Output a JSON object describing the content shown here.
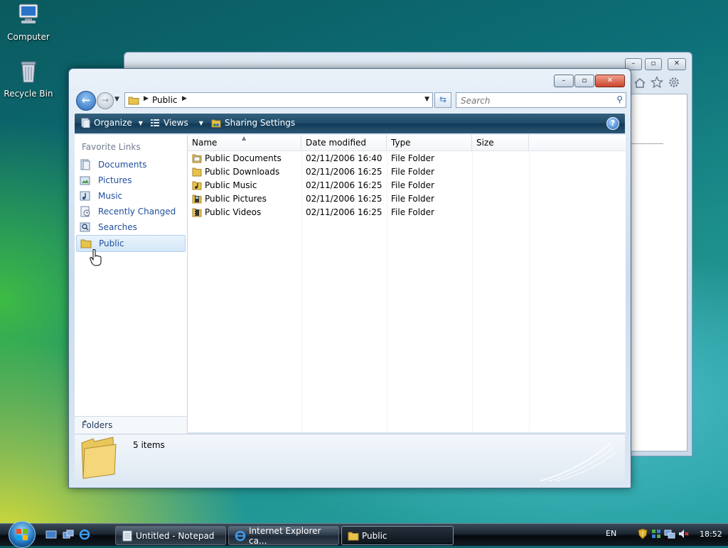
{
  "desktop": {
    "icons": [
      {
        "label": "Computer"
      },
      {
        "label": "Recycle Bin"
      }
    ]
  },
  "window": {
    "address": {
      "location": "Public"
    },
    "search": {
      "placeholder": "Search"
    },
    "toolbar": {
      "organize": "Organize",
      "views": "Views",
      "sharing": "Sharing Settings"
    },
    "nav": {
      "title": "Favorite Links",
      "items": [
        {
          "label": "Documents"
        },
        {
          "label": "Pictures"
        },
        {
          "label": "Music"
        },
        {
          "label": "Recently Changed"
        },
        {
          "label": "Searches"
        },
        {
          "label": "Public"
        }
      ],
      "folders_label": "Folders"
    },
    "columns": [
      "Name",
      "Date modified",
      "Type",
      "Size"
    ],
    "files": [
      {
        "name": "Public Documents",
        "date": "02/11/2006 16:40",
        "type": "File Folder",
        "size": ""
      },
      {
        "name": "Public Downloads",
        "date": "02/11/2006 16:25",
        "type": "File Folder",
        "size": ""
      },
      {
        "name": "Public Music",
        "date": "02/11/2006 16:25",
        "type": "File Folder",
        "size": ""
      },
      {
        "name": "Public Pictures",
        "date": "02/11/2006 16:25",
        "type": "File Folder",
        "size": ""
      },
      {
        "name": "Public Videos",
        "date": "02/11/2006 16:25",
        "type": "File Folder",
        "size": ""
      }
    ],
    "details": {
      "count": "5 items"
    }
  },
  "taskbar": {
    "tasks": [
      {
        "label": "Untitled - Notepad"
      },
      {
        "label": "Internet Explorer ca..."
      },
      {
        "label": "Public"
      }
    ],
    "language": "EN",
    "clock": "18:52"
  },
  "colors": {
    "link_blue": "#1f4e9c",
    "toolbar_dark": "#1f4b68",
    "close_red": "#c8452e"
  }
}
